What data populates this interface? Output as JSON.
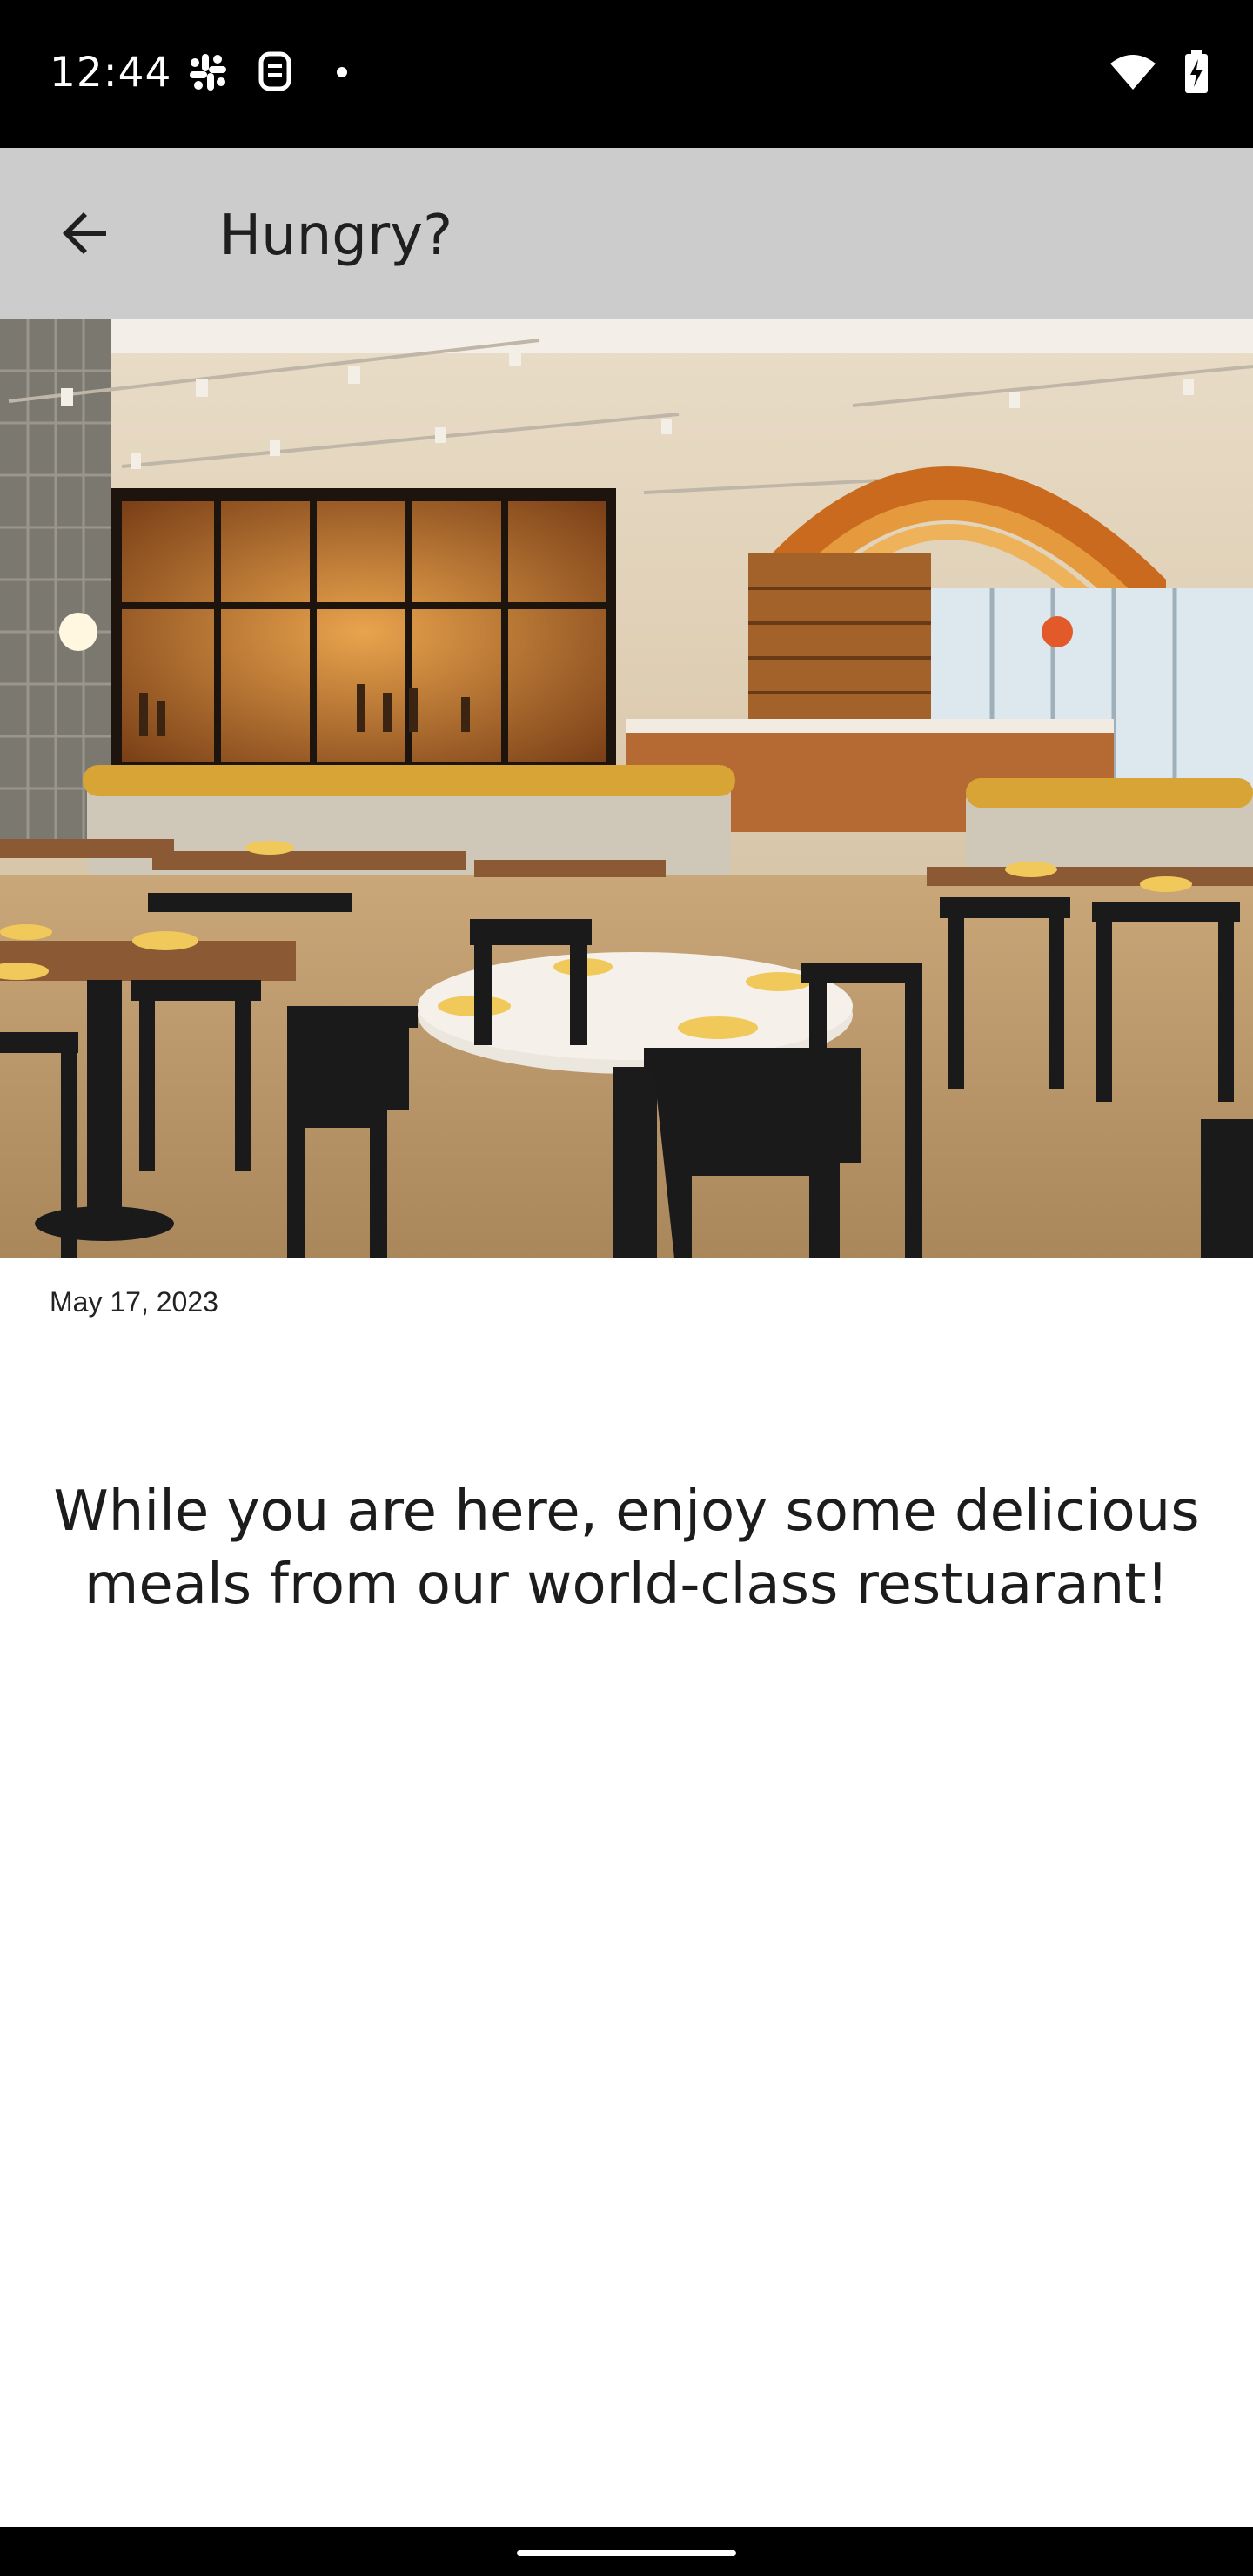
{
  "status_bar": {
    "time": "12:44",
    "left_icons": [
      "slack-icon",
      "robot-icon",
      "dot-icon"
    ],
    "right_icons": [
      "wifi-icon",
      "battery-charging-icon"
    ]
  },
  "app_bar": {
    "title": "Hungry?",
    "back_icon": "arrow-back-icon",
    "background": "#cccccc"
  },
  "hero": {
    "description_icon": "restaurant-photo"
  },
  "post": {
    "date": "May 17, 2023",
    "body": "While you are here, enjoy some delicious meals from our world-class restuarant!"
  }
}
